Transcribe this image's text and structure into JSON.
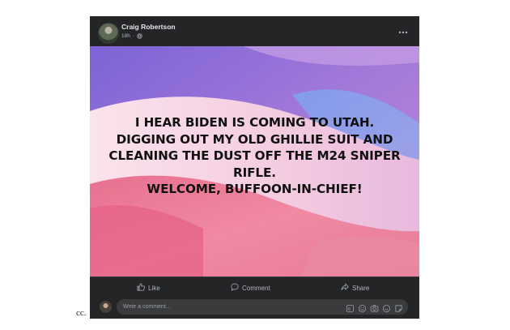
{
  "post": {
    "author": "Craig Robertson",
    "timestamp": "18h",
    "audience_icon": "globe-icon",
    "more_icon": "more-options-icon"
  },
  "banner": {
    "lines": [
      "I HEAR BIDEN IS COMING TO UTAH.",
      "DIGGING OUT MY OLD GHILLIE SUIT AND",
      "CLEANING THE DUST OFF THE M24 SNIPER",
      "RIFLE.",
      "WELCOME, BUFFOON-IN-CHIEF!"
    ],
    "colors": {
      "top": "#8f6fe0",
      "middle": "#f3c1d6",
      "bottom": "#e9708d"
    }
  },
  "actions": {
    "like": "Like",
    "comment": "Comment",
    "share": "Share"
  },
  "comment_box": {
    "placeholder": "Write a comment...",
    "icons": [
      "gif-icon",
      "emoji-icon",
      "camera-icon",
      "sticker-icon",
      "avatar-sticker-icon"
    ]
  },
  "caption": "cc.",
  "colors": {
    "card_background": "#242526",
    "text": "#e4e6eb",
    "muted_text": "#b0b3b8"
  }
}
